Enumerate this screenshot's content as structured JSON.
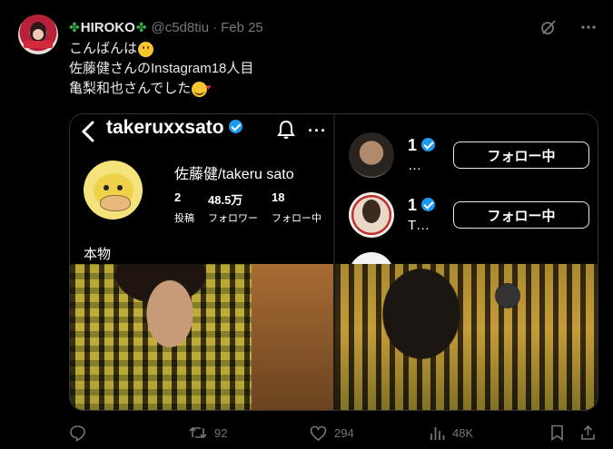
{
  "author": {
    "name": "HIROKO",
    "name_prefix": "✤",
    "name_suffix": "✤",
    "handle": "@c5d8tiu",
    "separator": "·",
    "date": "Feb 25"
  },
  "header_icons": [
    "grok-icon",
    "more-icon"
  ],
  "tweet_text": {
    "line1": "こんばんは",
    "line2": "佐藤健さんのInstagram18人目",
    "line3": "亀梨和也さんでした"
  },
  "screenshot": {
    "username": "takeruxxsato",
    "display_name": "佐藤健/takeru sato",
    "posts_count": "2",
    "posts_label": "投稿",
    "followers_count": "48.5万",
    "followers_label": "フォロワー",
    "following_count": "18",
    "following_label": "フォロー中",
    "bio": "本物",
    "following_list": [
      {
        "name": "1",
        "sub": "…",
        "button": "フォロー中"
      },
      {
        "name": "1",
        "sub": "T…",
        "button": "フォロー中"
      }
    ]
  },
  "actions": {
    "replies": "",
    "retweets": "92",
    "likes": "294",
    "views": "48K"
  }
}
